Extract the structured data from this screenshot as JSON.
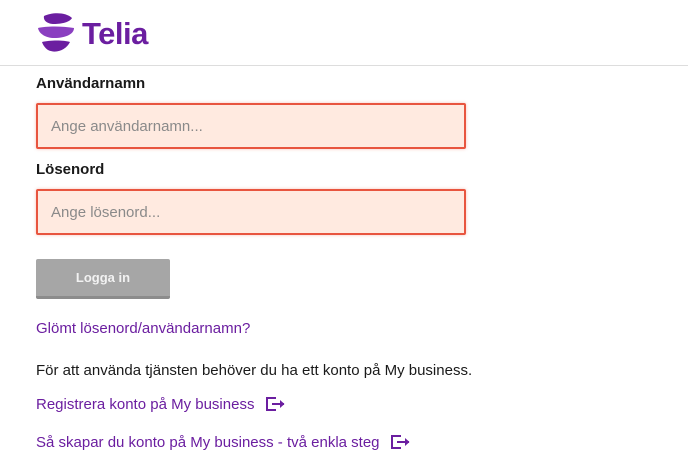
{
  "brand": {
    "name": "Telia",
    "color": "#6b1ea0",
    "logo_icon": "telia-globe-icon"
  },
  "form": {
    "username": {
      "label": "Användarnamn",
      "placeholder": "Ange användarnamn...",
      "value": ""
    },
    "password": {
      "label": "Lösenord",
      "placeholder": "Ange lösenord...",
      "value": ""
    },
    "login_button": "Logga in",
    "error_color": "#e8553f",
    "error_background": "#ffeae0",
    "button_color": "#a6a6a6"
  },
  "links": {
    "forgot": "Glömt lösenord/användarnamn?",
    "register": "Registrera konto på My business",
    "howto": "Så skapar du konto på My business - två enkla steg",
    "external_icon": "external-link-icon"
  },
  "info_text": "För att använda tjänsten behöver du ha ett konto på My business."
}
